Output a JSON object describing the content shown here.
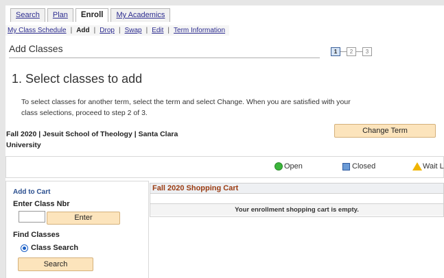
{
  "tabs": [
    {
      "label": "Search",
      "active": false
    },
    {
      "label": "Plan",
      "active": false
    },
    {
      "label": "Enroll",
      "active": true
    },
    {
      "label": "My Academics",
      "active": false
    }
  ],
  "subnav": {
    "items": [
      {
        "label": "My Class Schedule",
        "current": false
      },
      {
        "label": "Add",
        "current": true
      },
      {
        "label": "Drop",
        "current": false
      },
      {
        "label": "Swap",
        "current": false
      },
      {
        "label": "Edit",
        "current": false
      },
      {
        "label": "Term Information",
        "current": false
      }
    ],
    "separator": "|"
  },
  "header": {
    "title": "Add Classes",
    "steps": [
      "1",
      "2",
      "3"
    ],
    "current_step": "1"
  },
  "section": {
    "title": "1.  Select classes to add",
    "instructions": "To select classes for another term, select the term and select Change.  When you are satisfied with your class selections, proceed to step 2 of 3."
  },
  "term": {
    "label": "Fall 2020 | Jesuit School of Theology | Santa Clara University",
    "change_button": "Change Term"
  },
  "legend": {
    "open": "Open",
    "closed": "Closed",
    "waitlist": "Wait List"
  },
  "add_panel": {
    "add_to_cart": "Add to Cart",
    "enter_class_nbr": "Enter Class Nbr",
    "class_nbr_value": "",
    "enter_button": "Enter",
    "find_classes": "Find Classes",
    "class_search_option": "Class Search",
    "search_button": "Search"
  },
  "cart": {
    "title": "Fall 2020 Shopping Cart",
    "empty_message": "Your enrollment shopping cart is empty."
  },
  "colors": {
    "open": "#3bb53b",
    "closed": "#6b9bd6",
    "waitlist": "#f0b400",
    "button_bg": "#fce4bc",
    "cart_title": "#9a3b11",
    "link": "#2b2b8f"
  },
  "icons": {
    "open": "green-circle-icon",
    "closed": "blue-square-icon",
    "waitlist": "yellow-triangle-icon"
  }
}
